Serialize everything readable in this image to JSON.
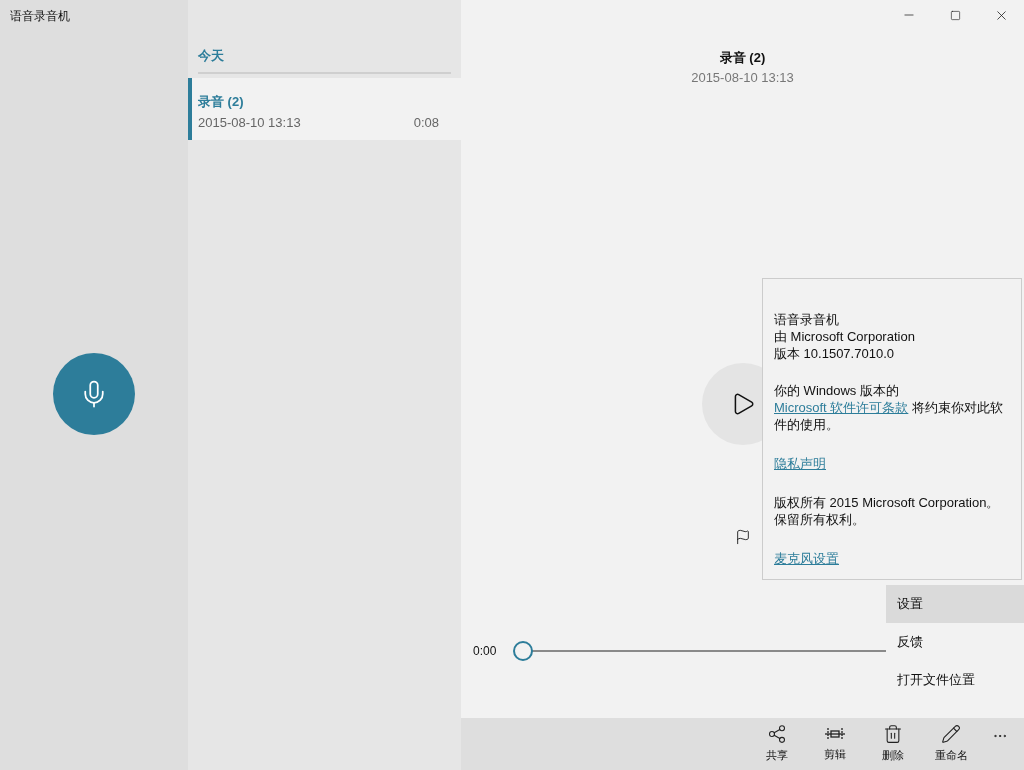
{
  "window": {
    "title": "语音录音机"
  },
  "recordings": {
    "group": "今天",
    "items": [
      {
        "name": "录音 (2)",
        "date": "2015-08-10 13:13",
        "duration": "0:08",
        "selected": true
      }
    ]
  },
  "detail": {
    "title": "录音 (2)",
    "date": "2015-08-10 13:13"
  },
  "player": {
    "time": "0:00",
    "level": 0
  },
  "about": {
    "app": "语音录音机",
    "publisher": "由 Microsoft Corporation",
    "version": "版本 10.1507.7010.0",
    "license": {
      "before": "你的 Windows 版本的",
      "link": "Microsoft 软件许可条款",
      "after": "将约束你对此软件的使用。"
    },
    "privacy": "隐私声明",
    "copyright": "版权所有 2015 Microsoft Corporation。保留所有权利。",
    "mic_settings": "麦克风设置"
  },
  "menu": [
    {
      "label": "设置",
      "selected": true
    },
    {
      "label": "反馈",
      "selected": false
    },
    {
      "label": "打开文件位置",
      "selected": false
    }
  ],
  "commands": [
    {
      "kind": "share",
      "label": "共享"
    },
    {
      "kind": "trim",
      "label": "剪辑"
    },
    {
      "kind": "delete",
      "label": "删除"
    },
    {
      "kind": "rename",
      "label": "重命名"
    }
  ]
}
